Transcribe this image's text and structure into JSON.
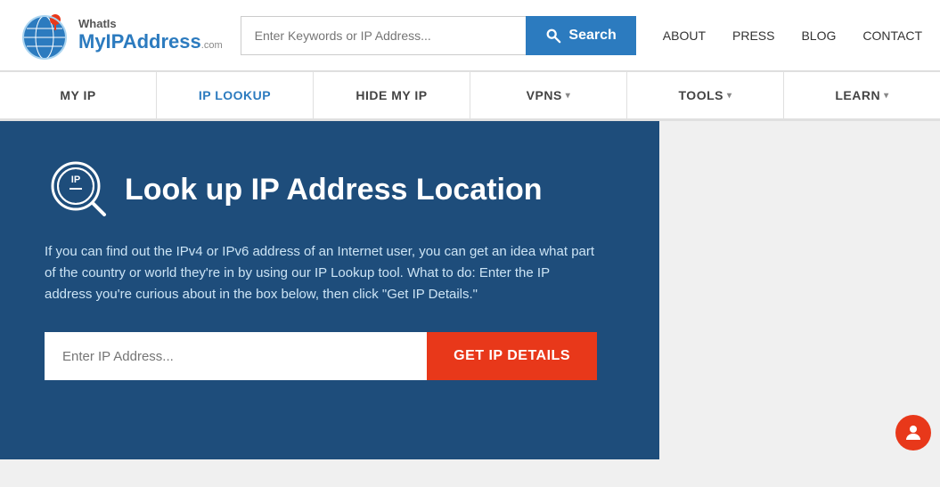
{
  "header": {
    "logo": {
      "whatis": "WhatIs",
      "myip": "MyIP",
      "address": "Address",
      "com": ".com"
    },
    "search": {
      "placeholder": "Enter Keywords or IP Address...",
      "button_label": "Search"
    },
    "top_nav": [
      {
        "id": "about",
        "label": "ABOUT"
      },
      {
        "id": "press",
        "label": "PRESS"
      },
      {
        "id": "blog",
        "label": "BLOG"
      },
      {
        "id": "contact",
        "label": "CONTACT"
      }
    ]
  },
  "main_nav": [
    {
      "id": "my-ip",
      "label": "MY IP",
      "has_dropdown": false
    },
    {
      "id": "ip-lookup",
      "label": "IP LOOKUP",
      "has_dropdown": false,
      "active": true
    },
    {
      "id": "hide-my-ip",
      "label": "HIDE MY IP",
      "has_dropdown": false
    },
    {
      "id": "vpns",
      "label": "VPNS",
      "has_dropdown": true
    },
    {
      "id": "tools",
      "label": "TOOLS",
      "has_dropdown": true
    },
    {
      "id": "learn",
      "label": "LEARN",
      "has_dropdown": true
    }
  ],
  "ip_lookup": {
    "title": "Look up IP Address Location",
    "description": "If you can find out the IPv4 or IPv6 address of an Internet user, you can get an idea what part of the country or world they're in by using our IP Lookup tool. What to do: Enter the IP address you're curious about in the box below, then click \"Get IP Details.\"",
    "input_placeholder": "Enter IP Address...",
    "button_label": "GET IP DETAILS"
  }
}
